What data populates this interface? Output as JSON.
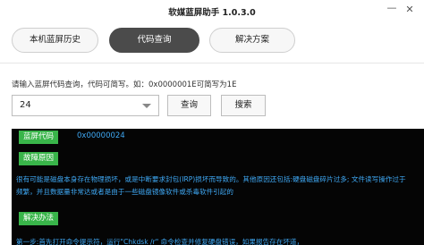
{
  "window": {
    "title": "软媒蓝屏助手 1.0.3.0",
    "minimize_glyph": "—",
    "close_glyph": "✕"
  },
  "tabs": [
    {
      "label": "本机蓝屏历史",
      "active": false
    },
    {
      "label": "代码查询",
      "active": true
    },
    {
      "label": "解决方案",
      "active": false
    }
  ],
  "query": {
    "hint": "请输入蓝屏代码查询，代码可简写。如：0x0000001E可简写为1E",
    "selected_value": "24",
    "query_button": "查询",
    "search_button": "搜索"
  },
  "result": {
    "code_label": "蓝屏代码",
    "code_value": "0x00000024",
    "cause_label": "故障原因",
    "cause_text": "很有可能是磁盘本身存在物理损坏，或是中断要求封包(IRP)损坏而导致的。其他原因还包括:硬盘磁盘碎片过多; 文件读写操作过于频繁，并且数据量非常达或者是由于一些磁盘镜像软件或杀毒软件引起的",
    "fix_label": "解决办法",
    "fix_text": "第一步:首先打开命令提示符，运行\"Chkdsk /r\" 命令检查并修复硬盘错误，如果报告存在坏道，"
  },
  "colors": {
    "tag_green": "#39b54a",
    "console_text_blue": "#3fa9f5",
    "console_bg": "#050505",
    "active_tab": "#4b4b4b"
  }
}
